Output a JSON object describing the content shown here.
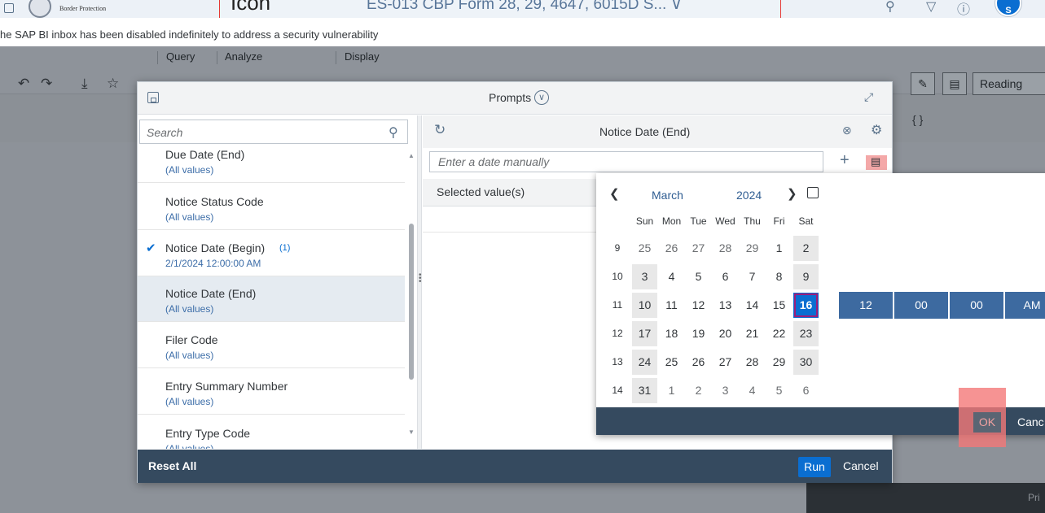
{
  "shell": {
    "brand": "Border Protection",
    "title": "ES-013 CBP Form 28, 29, 4647, 6015D S... ∨",
    "avatar": "S",
    "overlay_label": "Icon"
  },
  "notice": "he SAP BI inbox has been disabled indefinitely to address a security vulnerability",
  "toolbar": {
    "groups": [
      "Query",
      "Analyze",
      "Display"
    ],
    "reading_label": "Reading",
    "braces": "{ }",
    "footer_text": "Pri"
  },
  "dialog": {
    "title": "Prompts",
    "search_placeholder": "Search",
    "items": [
      {
        "name": "Due Date (End)",
        "value": "(All values)",
        "checked": false,
        "count": ""
      },
      {
        "name": "Notice Status Code",
        "value": "(All values)",
        "checked": false,
        "count": ""
      },
      {
        "name": "Notice Date (Begin)",
        "value": "2/1/2024 12:00:00 AM",
        "checked": true,
        "count": "(1)"
      },
      {
        "name": "Notice Date (End)",
        "value": "(All values)",
        "checked": false,
        "count": ""
      },
      {
        "name": "Filer Code",
        "value": "(All values)",
        "checked": false,
        "count": ""
      },
      {
        "name": "Entry Summary Number",
        "value": "(All values)",
        "checked": false,
        "count": ""
      },
      {
        "name": "Entry Type Code",
        "value": "(All values)",
        "checked": false,
        "count": ""
      }
    ],
    "right_title": "Notice Date (End)",
    "date_placeholder": "Enter a date manually",
    "selected_values_label": "Selected value(s)",
    "reset_all": "Reset All",
    "run": "Run",
    "cancel": "Cancel"
  },
  "picker": {
    "month": "March",
    "year": "2024",
    "weekdays": [
      "Sun",
      "Mon",
      "Tue",
      "Wed",
      "Thu",
      "Fri",
      "Sat"
    ],
    "weeks": [
      {
        "num": "9",
        "days": [
          "25",
          "26",
          "27",
          "28",
          "29",
          "1",
          "2"
        ]
      },
      {
        "num": "10",
        "days": [
          "3",
          "4",
          "5",
          "6",
          "7",
          "8",
          "9"
        ]
      },
      {
        "num": "11",
        "days": [
          "10",
          "11",
          "12",
          "13",
          "14",
          "15",
          "16"
        ]
      },
      {
        "num": "12",
        "days": [
          "17",
          "18",
          "19",
          "20",
          "21",
          "22",
          "23"
        ]
      },
      {
        "num": "13",
        "days": [
          "24",
          "25",
          "26",
          "27",
          "28",
          "29",
          "30"
        ]
      },
      {
        "num": "14",
        "days": [
          "31",
          "1",
          "2",
          "3",
          "4",
          "5",
          "6"
        ]
      }
    ],
    "selected_day": "16",
    "time": [
      "12",
      "00",
      "00",
      "AM"
    ],
    "ok": "OK",
    "cancel": "Canc"
  },
  "colors": {
    "accent": "#0a6ed1",
    "footer": "#354a5f",
    "time_segment": "#3d6aa0",
    "highlight": "#f4a8a8"
  }
}
